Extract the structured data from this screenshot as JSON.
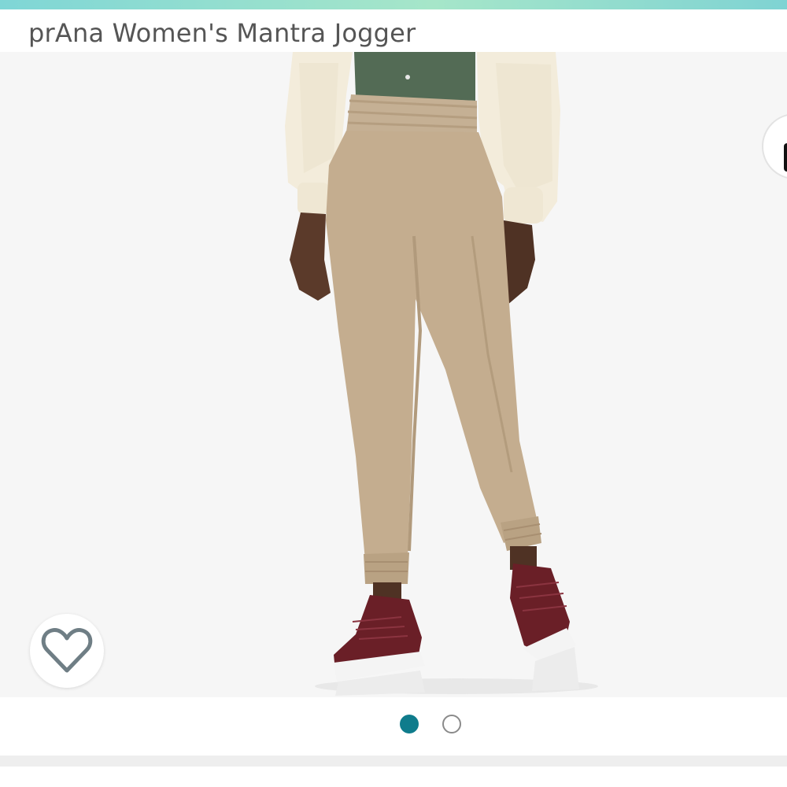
{
  "product": {
    "title": "prAna Women's Mantra Jogger"
  },
  "gallery": {
    "image_subject": "model wearing khaki jogger pants with cream fleece jacket and burgundy sneakers",
    "current_image": 1,
    "total_images": 2
  },
  "icons": {
    "wishlist": "heart-outline-icon",
    "share": "share-icon"
  },
  "colors": {
    "accent": "#0f7c8c",
    "title_text": "#555555",
    "banner_start": "#7fd6d6",
    "banner_end": "#a6e6c9"
  }
}
